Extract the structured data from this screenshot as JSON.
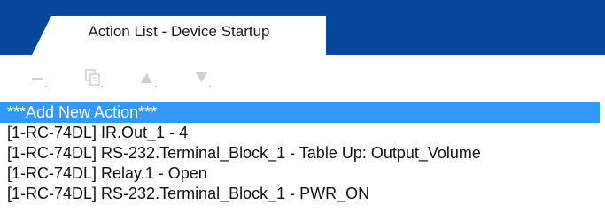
{
  "tab": {
    "label": "Action List - Device Startup"
  },
  "toolbar": {
    "buttons": [
      {
        "icon": "remove-icon",
        "enabled": false
      },
      {
        "icon": "copy-icon",
        "enabled": false
      },
      {
        "icon": "move-up-icon",
        "enabled": false
      },
      {
        "icon": "move-down-icon",
        "enabled": false
      }
    ]
  },
  "colors": {
    "header_bar": "#06479a",
    "selection": "#3399ff",
    "disabled_icon": "#d0d0d0"
  },
  "actions": {
    "selected_index": 0,
    "items": [
      "***Add New Action***",
      "[1-RC-74DL] IR.Out_1 - 4",
      "[1-RC-74DL] RS-232.Terminal_Block_1 - Table Up: Output_Volume",
      "[1-RC-74DL] Relay.1 - Open",
      "[1-RC-74DL] RS-232.Terminal_Block_1 - PWR_ON"
    ]
  }
}
